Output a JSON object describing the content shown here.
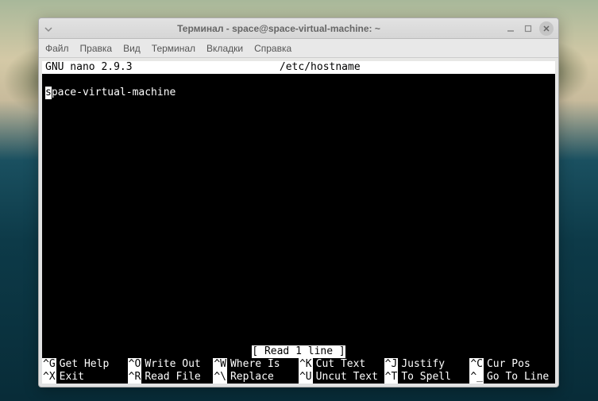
{
  "window": {
    "title": "Терминал - space@space-virtual-machine: ~"
  },
  "menubar": {
    "items": [
      "Файл",
      "Правка",
      "Вид",
      "Терминал",
      "Вкладки",
      "Справка"
    ]
  },
  "nano": {
    "app": "GNU nano 2.9.3",
    "filename": "/etc/hostname",
    "content_first_char": "s",
    "content_rest": "pace-virtual-machine",
    "status": "[ Read 1 line ]",
    "shortcuts": [
      {
        "key": "^G",
        "label": "Get Help"
      },
      {
        "key": "^O",
        "label": "Write Out"
      },
      {
        "key": "^W",
        "label": "Where Is"
      },
      {
        "key": "^K",
        "label": "Cut Text"
      },
      {
        "key": "^J",
        "label": "Justify"
      },
      {
        "key": "^C",
        "label": "Cur Pos"
      },
      {
        "key": "^X",
        "label": "Exit"
      },
      {
        "key": "^R",
        "label": "Read File"
      },
      {
        "key": "^\\",
        "label": "Replace"
      },
      {
        "key": "^U",
        "label": "Uncut Text"
      },
      {
        "key": "^T",
        "label": "To Spell"
      },
      {
        "key": "^_",
        "label": "Go To Line"
      }
    ]
  }
}
